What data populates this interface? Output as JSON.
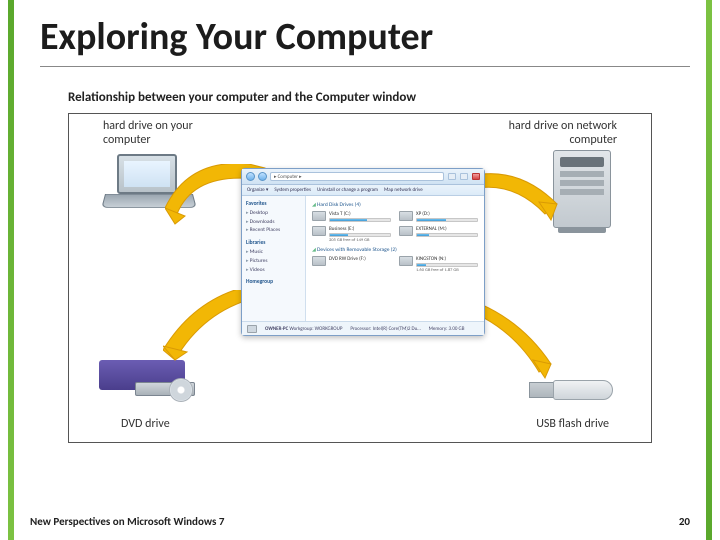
{
  "title": "Exploring Your Computer",
  "figure": {
    "caption": "Relationship between your computer and the Computer window",
    "labels": {
      "top_left": "hard drive on your\ncomputer",
      "top_right": "hard drive on network\ncomputer",
      "bottom_left": "DVD drive",
      "bottom_right": "USB flash drive"
    }
  },
  "window": {
    "address": "▸ Computer ▸",
    "toolbar": {
      "organize": "Organize ▾",
      "system_props": "System properties",
      "uninstall": "Uninstall or change a program",
      "map": "Map network drive"
    },
    "sidebar": {
      "favorites": {
        "header": "Favorites",
        "items": [
          "Desktop",
          "Downloads",
          "Recent Places"
        ]
      },
      "libraries": {
        "header": "Libraries",
        "items": [
          "Music",
          "Pictures",
          "Videos"
        ]
      },
      "homegroup": {
        "header": "Homegroup"
      }
    },
    "sections": {
      "hdd": {
        "title": "Hard Disk Drives (4)",
        "drives": [
          {
            "name": "Vista T (C:)",
            "free": ""
          },
          {
            "name": "XP (D:)",
            "free": ""
          },
          {
            "name": "Business (E:)",
            "free": "205 GB free of 149 GB"
          },
          {
            "name": "EXTERNAL (M:)",
            "free": ""
          }
        ]
      },
      "removable": {
        "title": "Devices with Removable Storage (2)",
        "drives": [
          {
            "name": "DVD RW Drive (F:)",
            "free": ""
          },
          {
            "name": "KINGSTON (N:)",
            "free": "1.60 GB free of 1.87 GB"
          }
        ]
      }
    },
    "footer": {
      "pcname": "OWNER-PC",
      "workgroup": "Workgroup: WORKGROUP",
      "processor": "Processor: Intel(R) Core(TM)2 Du…",
      "memory": "Memory: 3.00 GB"
    },
    "controls": {
      "min": "Minimize",
      "max": "Maximize",
      "close": "Close"
    }
  },
  "footer": {
    "book": "New Perspectives on Microsoft Windows 7",
    "page": "20"
  }
}
